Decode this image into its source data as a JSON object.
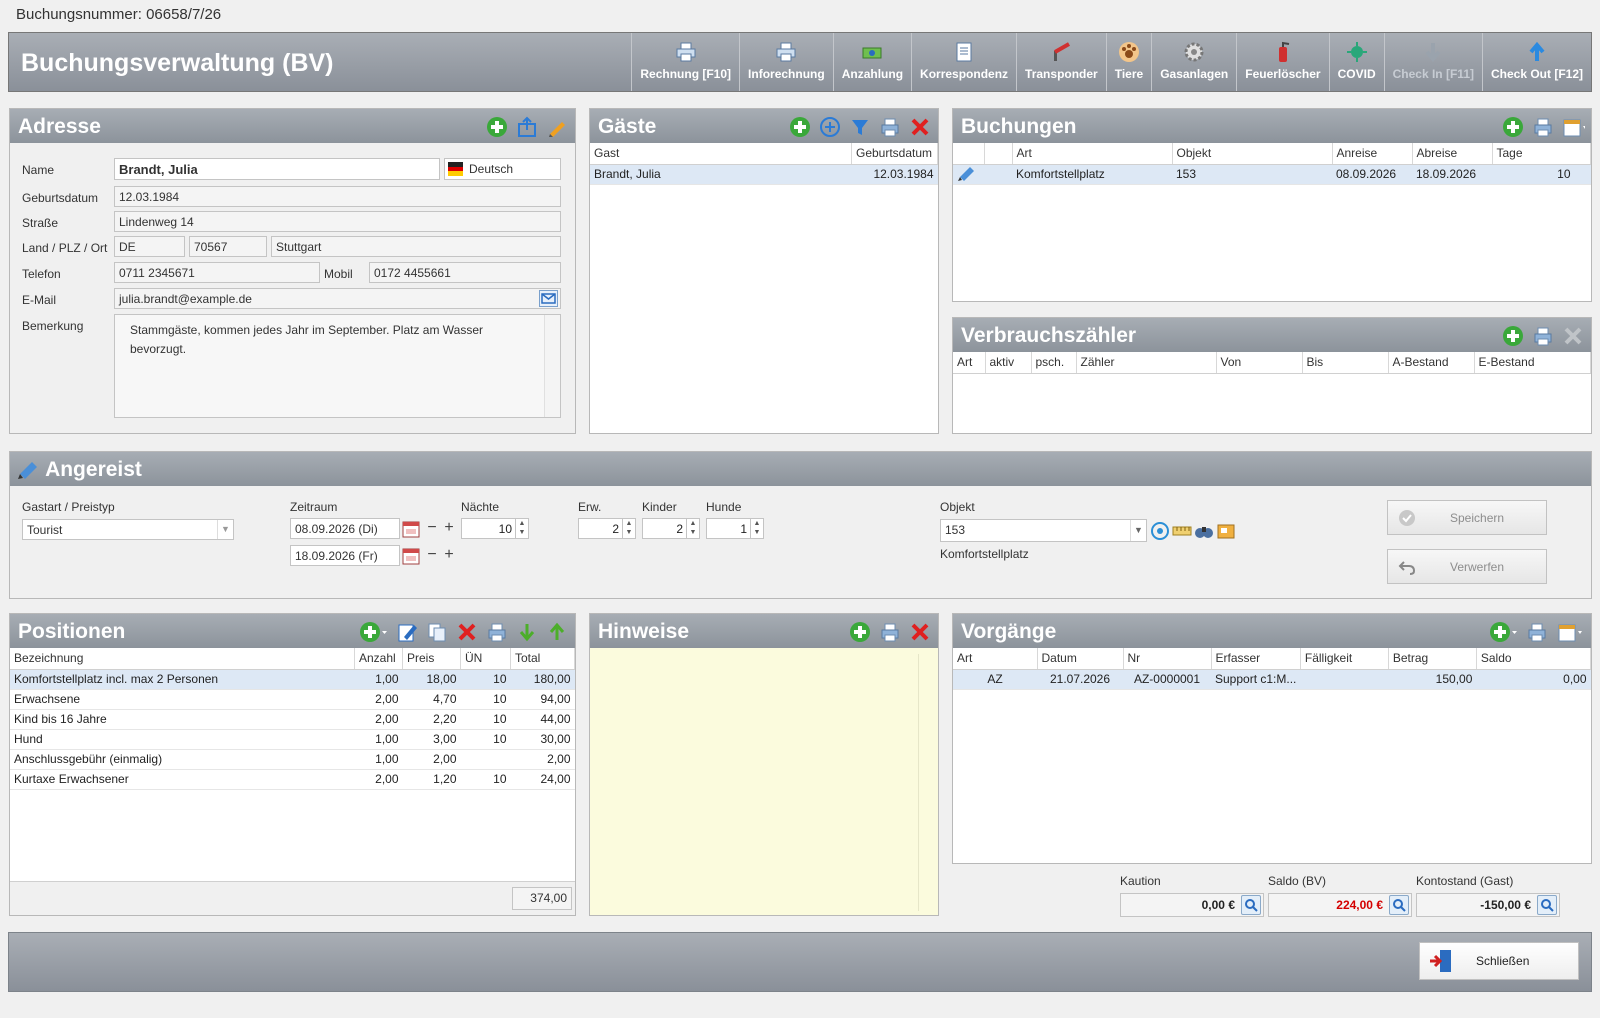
{
  "booking_number": "Buchungsnummer: 06658/7/26",
  "main_title": "Buchungsverwaltung (BV)",
  "toolbar": [
    {
      "label": "Rechnung [F10]",
      "icon": "printer-icon",
      "enabled": true
    },
    {
      "label": "Inforechnung",
      "icon": "printer-icon",
      "enabled": true
    },
    {
      "label": "Anzahlung",
      "icon": "money-icon",
      "enabled": true
    },
    {
      "label": "Korrespondenz",
      "icon": "document-icon",
      "enabled": true
    },
    {
      "label": "Transponder",
      "icon": "barrier-icon",
      "enabled": true
    },
    {
      "label": "Tiere",
      "icon": "paw-icon",
      "enabled": true
    },
    {
      "label": "Gasanlagen",
      "icon": "gear-icon",
      "enabled": true
    },
    {
      "label": "Feuerlöscher",
      "icon": "fire-extinguisher-icon",
      "enabled": true
    },
    {
      "label": "COVID",
      "icon": "virus-icon",
      "enabled": true
    },
    {
      "label": "Check In [F11]",
      "icon": "arrow-down-icon",
      "enabled": false
    },
    {
      "label": "Check Out [F12]",
      "icon": "arrow-up-icon",
      "enabled": true
    }
  ],
  "address": {
    "title": "Adresse",
    "labels": {
      "name": "Name",
      "birthdate": "Geburtsdatum",
      "street": "Straße",
      "country_zip_city": "Land / PLZ / Ort",
      "phone": "Telefon",
      "mobile": "Mobil",
      "email": "E-Mail",
      "remark": "Bemerkung"
    },
    "name": "Brandt, Julia",
    "language": "Deutsch",
    "birthdate": "12.03.1984",
    "street": "Lindenweg 14",
    "country": "DE",
    "zip": "70567",
    "city": "Stuttgart",
    "phone": "0711 2345671",
    "mobile": "0172 4455661",
    "email": "julia.brandt@example.de",
    "remark": "Stammgäste, kommen jedes Jahr im September. Platz am Wasser bevorzugt."
  },
  "guests": {
    "title": "Gäste",
    "columns": [
      "Gast",
      "Geburtsdatum"
    ],
    "rows": [
      [
        "Brandt, Julia",
        "12.03.1984"
      ]
    ]
  },
  "bookings": {
    "title": "Buchungen",
    "columns": [
      "",
      "Art",
      "Objekt",
      "Anreise",
      "Abreise",
      "Tage"
    ],
    "rows": [
      [
        "",
        "Komfortstellplatz",
        "153",
        "08.09.2026",
        "18.09.2026",
        "10"
      ]
    ]
  },
  "meters": {
    "title": "Verbrauchszähler",
    "columns": [
      "Art",
      "aktiv",
      "psch.",
      "Zähler",
      "Von",
      "Bis",
      "A-Bestand",
      "E-Bestand"
    ]
  },
  "status": {
    "title": "Angereist",
    "labels": {
      "guest_type": "Gastart / Preistyp",
      "period": "Zeitraum",
      "nights": "Nächte",
      "adults": "Erw.",
      "children": "Kinder",
      "dogs": "Hunde",
      "object": "Objekt"
    },
    "guest_type": "Tourist",
    "arrival": "08.09.2026 (Di)",
    "departure": "18.09.2026 (Fr)",
    "nights": "10",
    "adults": "2",
    "children": "2",
    "dogs": "1",
    "object": "153",
    "object_type": "Komfortstellplatz",
    "save_label": "Speichern",
    "discard_label": "Verwerfen"
  },
  "positions": {
    "title": "Positionen",
    "columns": [
      "Bezeichnung",
      "Anzahl",
      "Preis",
      "ÜN",
      "Total"
    ],
    "rows": [
      [
        "Komfortstellplatz incl. max 2 Personen",
        "1,00",
        "18,00",
        "10",
        "180,00"
      ],
      [
        "Erwachsene",
        "2,00",
        "4,70",
        "10",
        "94,00"
      ],
      [
        "Kind bis 16 Jahre",
        "2,00",
        "2,20",
        "10",
        "44,00"
      ],
      [
        "Hund",
        "1,00",
        "3,00",
        "10",
        "30,00"
      ],
      [
        "Anschlussgebühr (einmalig)",
        "1,00",
        "2,00",
        "",
        "2,00"
      ],
      [
        "Kurtaxe Erwachsener",
        "2,00",
        "1,20",
        "10",
        "24,00"
      ]
    ],
    "total": "374,00"
  },
  "notes": {
    "title": "Hinweise"
  },
  "transactions": {
    "title": "Vorgänge",
    "columns": [
      "Art",
      "Datum",
      "Nr",
      "Erfasser",
      "Fälligkeit",
      "Betrag",
      "Saldo"
    ],
    "rows": [
      [
        "AZ",
        "21.07.2026",
        "AZ-0000001",
        "Support c1:M...",
        "",
        "150,00",
        "0,00"
      ]
    ],
    "deposit_label": "Kaution",
    "deposit": "0,00 €",
    "balance_label": "Saldo (BV)",
    "balance": "224,00 €",
    "account_label": "Kontostand (Gast)",
    "account": "-150,00 €"
  },
  "close_label": "Schließen",
  "colors": {
    "header": "#9aa0a8",
    "accent_green": "#3aa83a",
    "accent_red": "#e02020",
    "notes_bg": "#fbfbdd",
    "selection": "#dde8f5",
    "negative": "#d40000"
  }
}
